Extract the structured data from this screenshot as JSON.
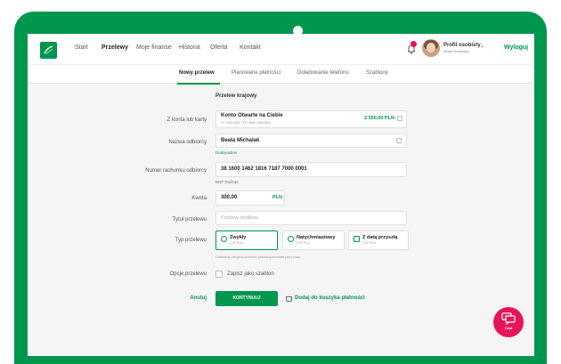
{
  "nav": {
    "items": [
      {
        "label": "Start",
        "active": false
      },
      {
        "label": "Przelewy",
        "active": true
      },
      {
        "label": "Moje finanse",
        "active": false
      },
      {
        "label": "Historia",
        "active": false
      },
      {
        "label": "Oferta",
        "active": false
      },
      {
        "label": "Kontakt",
        "active": false
      }
    ],
    "profile_title": "Profil osobisty",
    "profile_sub": "Beata Kowalska",
    "logout": "Wyloguj"
  },
  "subnav": {
    "tabs": [
      {
        "label": "Nowy przelew",
        "active": true
      },
      {
        "label": "Planowane płatności",
        "active": false
      },
      {
        "label": "Doładowanie telefonu",
        "active": false
      },
      {
        "label": "Szablony",
        "active": false
      }
    ]
  },
  "form": {
    "section_title": "Przelew krajowy",
    "from_label": "Z konta lub karty",
    "account_name": "Konto Otwarte na Ciebie",
    "account_number": "81 1600 0003 7157 4895 1868 3821",
    "account_balance": "2 550,00 PLN",
    "recipient_label": "Nazwa odbiorcy",
    "recipient_value": "Beata Michalak",
    "add_address_link": "Dodaj adres",
    "account_no_label": "Numer rachunku odbiorcy",
    "account_no_value": "38 1600 1462 1816 7187 7000 0001",
    "bank_name": "BNP Paribas",
    "amount_label": "Kwota",
    "amount_value": "300,00",
    "amount_currency": "PLN",
    "title_label": "Tytuł przelewu",
    "title_placeholder": "Przelew środków",
    "type_label": "Typ przelewu",
    "types": [
      {
        "title": "Zwykły",
        "sub": "0,00 PLN",
        "selected": true
      },
      {
        "title": "Natychmiastowy",
        "sub": "5,00 PLN",
        "selected": false
      },
      {
        "title": "Z datą przyszłą",
        "sub": "0,00 PLN",
        "selected": false
      }
    ],
    "type_hint": "Odbiorca otrzyma przelew prawdopodobnie jutro rano",
    "options_label": "Opcje przelewu",
    "save_template": "Zapisz jako szablon",
    "cancel": "Anuluj",
    "continue": "KONTYNUUJ",
    "add_to_basket": "Dodaj do koszyka płatności"
  },
  "chat": {
    "label": "Czat"
  },
  "colors": {
    "brand": "#00964e",
    "accent": "#e6145a"
  }
}
